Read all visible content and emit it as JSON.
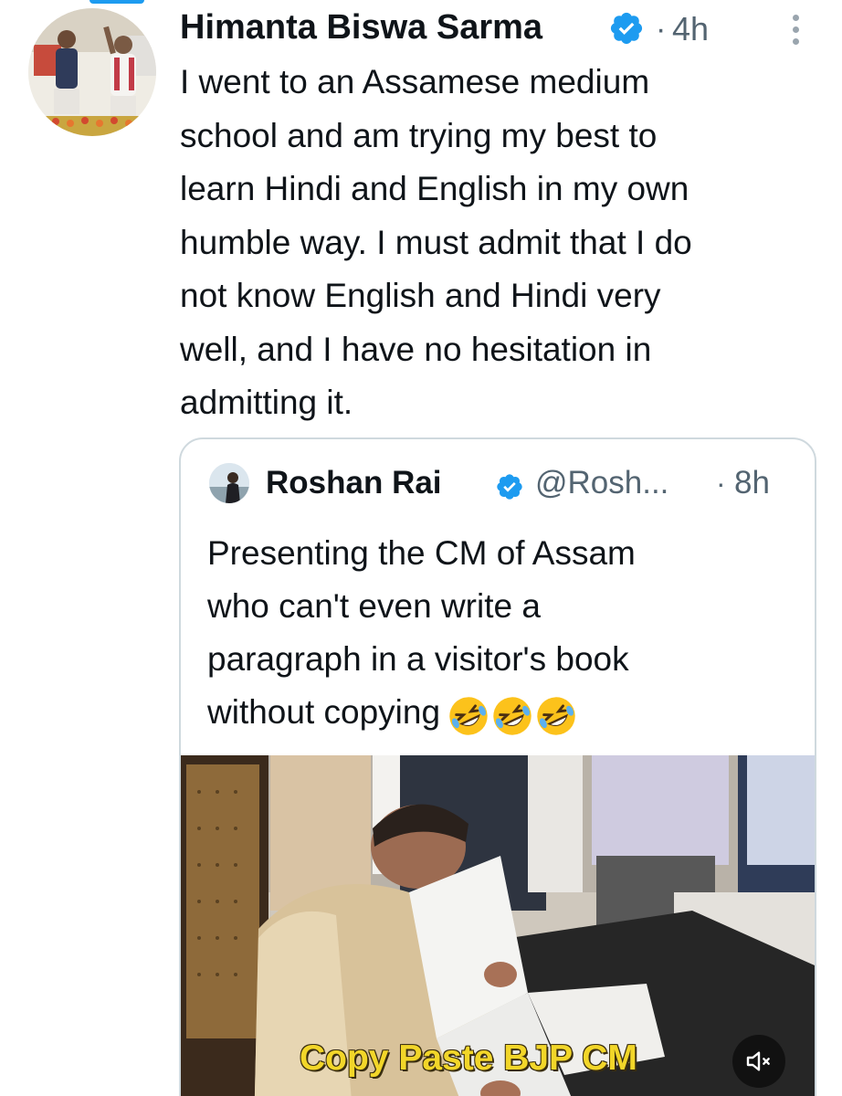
{
  "tweet": {
    "author_name": "Himanta Biswa Sarma",
    "separator": "·",
    "time": "4h",
    "text_lines": [
      "I went to an Assamese medium",
      "school and am trying my best to",
      "learn Hindi and English in my own",
      "humble way. I must admit that I do",
      "not know English and Hindi very",
      "well, and I have no hesitation in",
      "admitting it."
    ]
  },
  "quoted_tweet": {
    "author_name": "Roshan Rai",
    "handle": "@Rosh...",
    "separator": "·",
    "time": "8h",
    "text_lines": [
      "Presenting the CM of Assam",
      "who can't even write a",
      "paragraph in a visitor's book",
      "without copying"
    ],
    "emoji": [
      "rolling-on-floor-laughing",
      "rolling-on-floor-laughing",
      "rolling-on-floor-laughing"
    ],
    "video": {
      "caption": "Copy Paste BJP CM",
      "muted": true
    }
  },
  "icons": {
    "verified": "verified-badge-icon",
    "more": "more-options-icon",
    "mute": "speaker-muted-icon"
  },
  "colors": {
    "accent": "#1d9bf0",
    "secondary_text": "#536471",
    "border": "#cfd9de",
    "caption": "#f2d629"
  }
}
